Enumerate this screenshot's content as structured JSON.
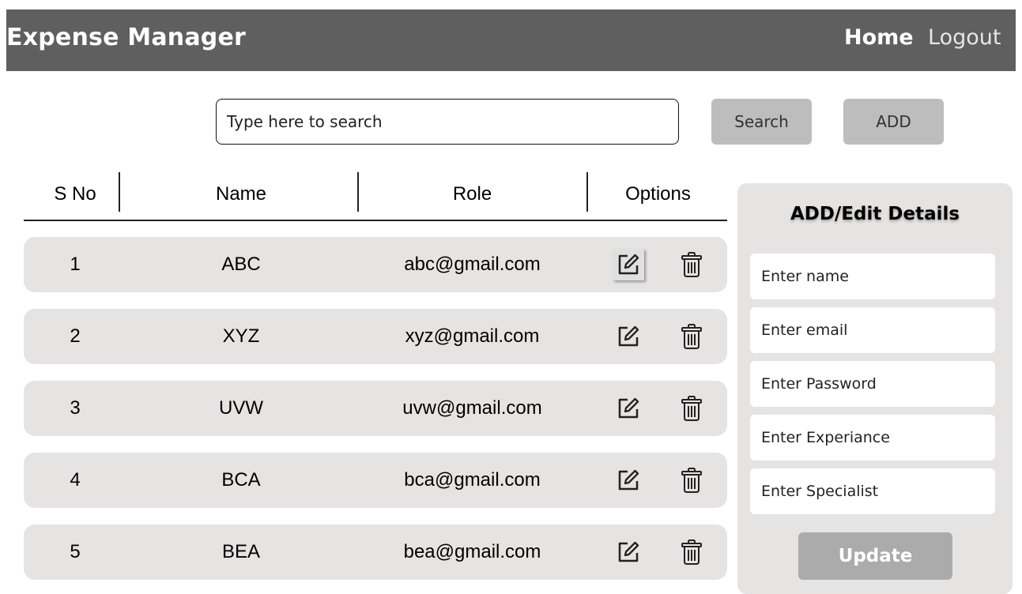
{
  "header": {
    "title": "Expense Manager",
    "nav": {
      "home": "Home",
      "logout": "Logout"
    }
  },
  "search": {
    "placeholder": "Type here to search",
    "search_label": "Search",
    "add_label": "ADD"
  },
  "table": {
    "columns": [
      "S No",
      "Name",
      "Role",
      "Options"
    ],
    "rows": [
      {
        "sno": "1",
        "name": "ABC",
        "role": "abc@gmail.com"
      },
      {
        "sno": "2",
        "name": "XYZ",
        "role": "xyz@gmail.com"
      },
      {
        "sno": "3",
        "name": "UVW",
        "role": "uvw@gmail.com"
      },
      {
        "sno": "4",
        "name": "BCA",
        "role": "bca@gmail.com"
      },
      {
        "sno": "5",
        "name": "BEA",
        "role": "bea@gmail.com"
      }
    ],
    "row_icons": {
      "edit": "edit-icon",
      "delete": "trash-icon"
    }
  },
  "panel": {
    "title": "ADD/Edit Details",
    "fields": [
      {
        "placeholder": "Enter name"
      },
      {
        "placeholder": "Enter email"
      },
      {
        "placeholder": "Enter Password"
      },
      {
        "placeholder": "Enter Experiance"
      },
      {
        "placeholder": "Enter Specialist"
      }
    ],
    "update_label": "Update"
  },
  "colors": {
    "topbar": "#5f5f5f",
    "row_bg": "#e6e3e3",
    "button_grey": "#bdbdbd",
    "update_button": "#ababab"
  }
}
